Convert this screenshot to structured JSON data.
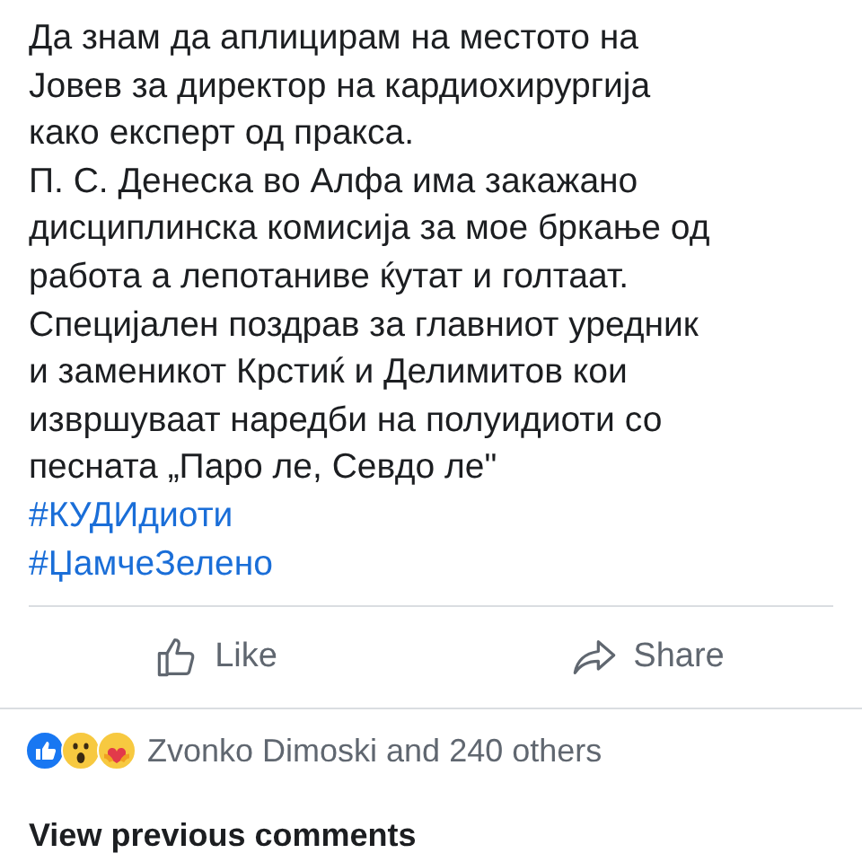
{
  "post": {
    "lines": [
      "Да знам да аплицирам на местото на",
      "Јовев за директор на кардиохирургија",
      "како експерт од пракса.",
      "П. С. Денеска во Алфа има закажано",
      "дисциплинска комисија за мое бркање од",
      "работа а лепотаниве ќутат и голтаат.",
      "Специјален поздрав за главниот уредник",
      "и заменикот Крстиќ и Делимитов кои",
      "извршуваат наредби на полуидиоти со",
      "песната „Паро ле, Севдо ле\""
    ],
    "hashtags": [
      "#КУДИдиоти",
      "#ЏамчеЗелено"
    ]
  },
  "actions": [
    {
      "kind": "like",
      "label": "Like"
    },
    {
      "kind": "share",
      "label": "Share"
    }
  ],
  "reactions": {
    "icons": [
      {
        "kind": "like"
      },
      {
        "kind": "wow"
      },
      {
        "kind": "care"
      }
    ],
    "summary": "Zvonko Dimoski and 240 others"
  },
  "comments_link": "View previous comments"
}
